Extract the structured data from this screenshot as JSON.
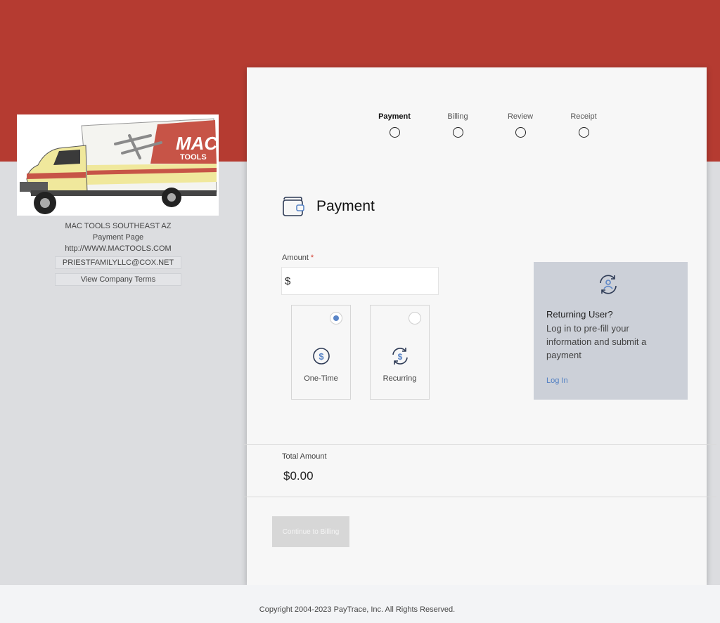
{
  "company": {
    "logo_text_main": "MAC",
    "logo_text_sub": "TOOLS",
    "name": "MAC TOOLS SOUTHEAST AZ",
    "page_label": "Payment Page",
    "website": "http://WWW.MACTOOLS.COM",
    "email": "PRIESTFAMILYLLC@COX.NET",
    "terms_button": "View Company Terms"
  },
  "steps": [
    {
      "label": "Payment",
      "active": true
    },
    {
      "label": "Billing",
      "active": false
    },
    {
      "label": "Review",
      "active": false
    },
    {
      "label": "Receipt",
      "active": false
    }
  ],
  "section": {
    "title": "Payment"
  },
  "amount": {
    "label": "Amount",
    "required_mark": "*",
    "prefix": "$",
    "value": ""
  },
  "payment_types": [
    {
      "label": "One-Time",
      "selected": true
    },
    {
      "label": "Recurring",
      "selected": false
    }
  ],
  "returning_user": {
    "title": "Returning User?",
    "description": "Log in to pre-fill your information and submit a payment",
    "login_link": "Log In"
  },
  "total": {
    "label": "Total Amount",
    "value": "$0.00"
  },
  "continue_button": "Continue to Billing",
  "footer": {
    "copyright": "Copyright 2004-2023 PayTrace, Inc. All Rights Reserved."
  },
  "colors": {
    "brand_red": "#b53b31",
    "accent_blue": "#5a85c7",
    "link_blue": "#4f7ec3"
  }
}
